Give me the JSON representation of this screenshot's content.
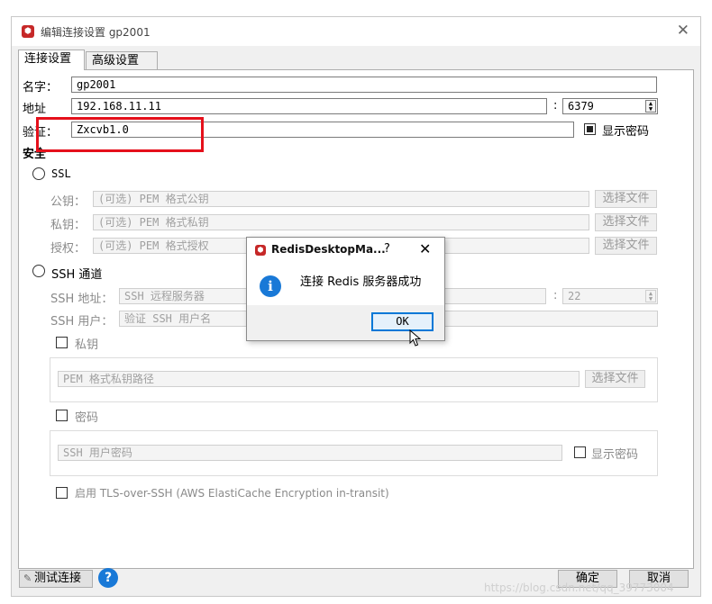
{
  "window": {
    "title": "编辑连接设置 gp2001",
    "logo_glyph": "⬢",
    "close_glyph": "✕"
  },
  "tabs": [
    {
      "label": "连接设置",
      "active": true
    },
    {
      "label": "高级设置",
      "active": false
    }
  ],
  "connection": {
    "name_label": "名字：",
    "name_value": "gp2001",
    "address_label": "地址",
    "address_value": "192.168.11.11",
    "port_separator": ":",
    "port_value": "6379",
    "auth_label": "验证：",
    "auth_value": "Zxcvb1.0",
    "show_password_label": "显示密码"
  },
  "security": {
    "section_label": "安全",
    "ssl": {
      "label": "SSL",
      "public_key_label": "公钥：",
      "public_key_placeholder": "(可选) PEM 格式公钥",
      "private_key_label": "私钥：",
      "private_key_placeholder": "(可选) PEM 格式私钥",
      "authority_label": "授权：",
      "authority_placeholder": "(可选) PEM 格式授权",
      "choose_file_label": "选择文件"
    },
    "ssh": {
      "label": "SSH 通道",
      "address_label": "SSH 地址：",
      "address_placeholder": "SSH 远程服务器",
      "port_separator": ":",
      "port_value": "22",
      "user_label": "SSH 用户：",
      "user_placeholder": "验证 SSH 用户名",
      "private_key_label": "私钥",
      "private_key_path_placeholder": "PEM 格式私钥路径",
      "choose_file_label": "选择文件",
      "password_label": "密码",
      "password_placeholder": "SSH 用户密码",
      "show_password_label": "显示密码",
      "tls_label": "启用 TLS-over-SSH (AWS ElastiCache Encryption in-transit)"
    }
  },
  "footer": {
    "test_button_label": "测试连接",
    "help_glyph": "?",
    "ok_label": "确定",
    "cancel_label": "取消"
  },
  "dialog": {
    "title": "RedisDesktopMa...",
    "help_glyph": "?",
    "close_glyph": "✕",
    "info_glyph": "i",
    "message": "连接 Redis 服务器成功",
    "ok_label": "OK"
  },
  "watermark": "https://blog.csdn.net/qq_39773004",
  "colors": {
    "highlight": "#e5101b",
    "accent": "#0078d7",
    "info": "#1979d7"
  }
}
